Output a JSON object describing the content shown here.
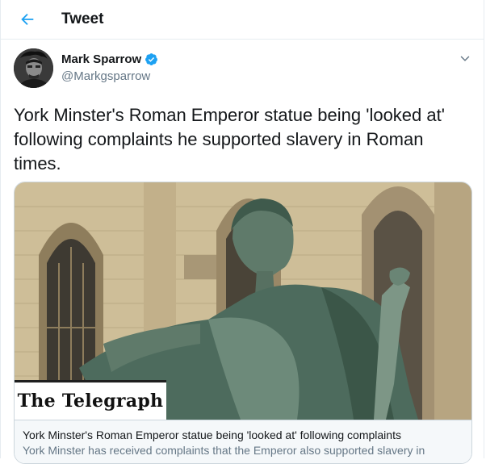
{
  "header": {
    "title": "Tweet",
    "back_icon": "arrow-left-icon"
  },
  "colors": {
    "accent": "#1da1f2",
    "text": "#14171a",
    "muted": "#657786",
    "border": "#e6ecf0"
  },
  "tweet": {
    "author_name": "Mark Sparrow",
    "author_handle": "@Markgsparrow",
    "verified": true,
    "text": "York Minster's Roman Emperor statue being 'looked at' following complaints he supported slavery in Roman times."
  },
  "card": {
    "source_logo": "The Telegraph",
    "title": "York Minster's Roman Emperor statue being 'looked at' following complaints",
    "description": "York Minster has received complaints that the Emperor also supported slavery in"
  }
}
